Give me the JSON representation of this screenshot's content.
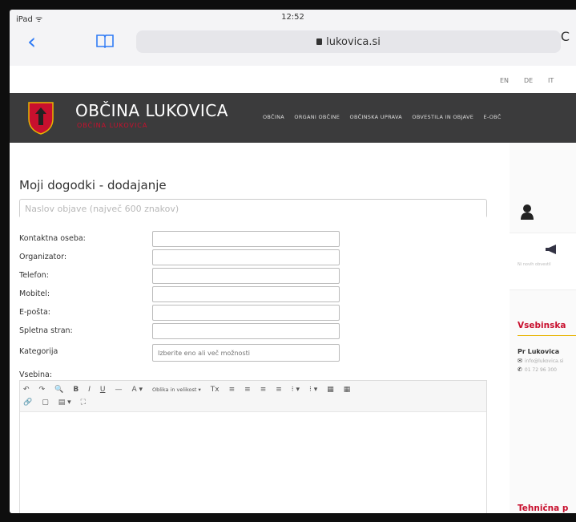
{
  "status_bar": {
    "left": "iPad ᯤ",
    "time": "12:52"
  },
  "browser": {
    "back_glyph": "‹",
    "url": "lukovica.si",
    "reload_glyph": "C"
  },
  "languages": [
    "EN",
    "DE",
    "IT"
  ],
  "site": {
    "title": "OBČINA LUKOVICA",
    "subtitle": "OBČINA LUKOVICA",
    "nav": [
      "OBČINA",
      "ORGANI OBČINE",
      "OBČINSKA UPRAVA",
      "OBVESTILA IN OBJAVE",
      "E-OBČ"
    ]
  },
  "form": {
    "page_title": "Moji dogodki - dodajanje",
    "title_placeholder": "Naslov objave (največ 600 znakov)",
    "fields": [
      {
        "label": "Kontaktna oseba:",
        "value": ""
      },
      {
        "label": "Organizator:",
        "value": ""
      },
      {
        "label": "Telefon:",
        "value": ""
      },
      {
        "label": "Mobitel:",
        "value": ""
      },
      {
        "label": "E-pošta:",
        "value": ""
      },
      {
        "label": "Spletna stran:",
        "value": ""
      },
      {
        "label": "Kategorija",
        "value": "Izberite eno ali več možnosti"
      }
    ],
    "content_label": "Vsebina:",
    "editor_toolbar": {
      "row1": [
        "↶",
        "↷",
        "🔍",
        "B",
        "I",
        "U",
        "—",
        "A ▾",
        "Oblika in velikost ▾",
        "Tx",
        "≡",
        "≡",
        "≡",
        "≡",
        "⁝ ▾",
        "⁝ ▾",
        "▦",
        "▦"
      ],
      "row2": [
        "🔗",
        "▢",
        "▤ ▾",
        "⛶"
      ]
    }
  },
  "sidebar": {
    "card_text": "Ni novih obvestil",
    "section1": "Vsebinska",
    "contact_name": "Pr Lukovica",
    "contact_email": "info@lukovica.si",
    "contact_phone": "01 72 96 300",
    "section2": "Tehnična p"
  },
  "colors": {
    "accent_red": "#c8102e",
    "header_bg": "#3b3b3c",
    "ios_blue": "#2f7bf5",
    "underline": "#e7b400"
  }
}
